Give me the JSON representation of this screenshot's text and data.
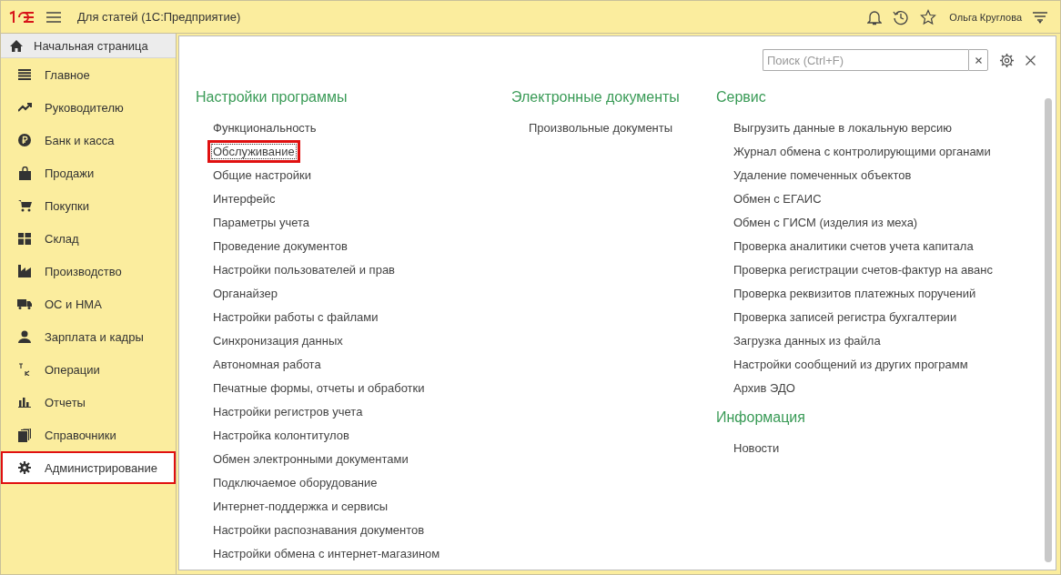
{
  "window": {
    "title": "Для статей  (1С:Предприятие)",
    "user": "Ольга Круглова"
  },
  "home_tab": {
    "label": "Начальная страница"
  },
  "sidebar": {
    "items": [
      {
        "label": "Главное",
        "selected": false
      },
      {
        "label": "Руководителю",
        "selected": false
      },
      {
        "label": "Банк и касса",
        "selected": false
      },
      {
        "label": "Продажи",
        "selected": false
      },
      {
        "label": "Покупки",
        "selected": false
      },
      {
        "label": "Склад",
        "selected": false
      },
      {
        "label": "Производство",
        "selected": false
      },
      {
        "label": "ОС и НМА",
        "selected": false
      },
      {
        "label": "Зарплата и кадры",
        "selected": false
      },
      {
        "label": "Операции",
        "selected": false
      },
      {
        "label": "Отчеты",
        "selected": false
      },
      {
        "label": "Справочники",
        "selected": false
      },
      {
        "label": "Администрирование",
        "selected": true
      }
    ]
  },
  "search": {
    "placeholder": "Поиск (Ctrl+F)"
  },
  "columns": [
    {
      "sections": [
        {
          "title": "Настройки программы",
          "items": [
            {
              "label": "Функциональность",
              "highlighted": false
            },
            {
              "label": "Обслуживание",
              "highlighted": true
            },
            {
              "label": "Общие настройки",
              "highlighted": false
            },
            {
              "label": "Интерфейс",
              "highlighted": false
            },
            {
              "label": "Параметры учета",
              "highlighted": false
            },
            {
              "label": "Проведение документов",
              "highlighted": false
            },
            {
              "label": "Настройки пользователей и прав",
              "highlighted": false
            },
            {
              "label": "Органайзер",
              "highlighted": false
            },
            {
              "label": "Настройки работы с файлами",
              "highlighted": false
            },
            {
              "label": "Синхронизация данных",
              "highlighted": false
            },
            {
              "label": "Автономная работа",
              "highlighted": false
            },
            {
              "label": "Печатные формы, отчеты и обработки",
              "highlighted": false
            },
            {
              "label": "Настройки регистров учета",
              "highlighted": false
            },
            {
              "label": "Настройка колонтитулов",
              "highlighted": false
            },
            {
              "label": "Обмен электронными документами",
              "highlighted": false
            },
            {
              "label": "Подключаемое оборудование",
              "highlighted": false
            },
            {
              "label": "Интернет-поддержка и сервисы",
              "highlighted": false
            },
            {
              "label": "Настройки распознавания документов",
              "highlighted": false
            },
            {
              "label": "Настройки обмена с интернет-магазином",
              "highlighted": false
            }
          ]
        }
      ]
    },
    {
      "sections": [
        {
          "title": "Электронные документы",
          "items": [
            {
              "label": "Произвольные документы",
              "highlighted": false
            }
          ]
        }
      ]
    },
    {
      "sections": [
        {
          "title": "Сервис",
          "items": [
            {
              "label": "Выгрузить данные в локальную версию",
              "highlighted": false
            },
            {
              "label": "Журнал обмена с контролирующими органами",
              "highlighted": false
            },
            {
              "label": "Удаление помеченных объектов",
              "highlighted": false
            },
            {
              "label": "Обмен с ЕГАИС",
              "highlighted": false
            },
            {
              "label": "Обмен с ГИСМ (изделия из меха)",
              "highlighted": false
            },
            {
              "label": "Проверка аналитики счетов учета капитала",
              "highlighted": false
            },
            {
              "label": "Проверка регистрации счетов-фактур на аванс",
              "highlighted": false
            },
            {
              "label": "Проверка реквизитов платежных поручений",
              "highlighted": false
            },
            {
              "label": "Проверка записей регистра бухгалтерии",
              "highlighted": false
            },
            {
              "label": "Загрузка данных из файла",
              "highlighted": false
            },
            {
              "label": "Настройки сообщений из других программ",
              "highlighted": false
            },
            {
              "label": "Архив ЭДО",
              "highlighted": false
            }
          ]
        },
        {
          "title": "Информация",
          "items": [
            {
              "label": "Новости",
              "highlighted": false
            }
          ]
        }
      ]
    }
  ]
}
